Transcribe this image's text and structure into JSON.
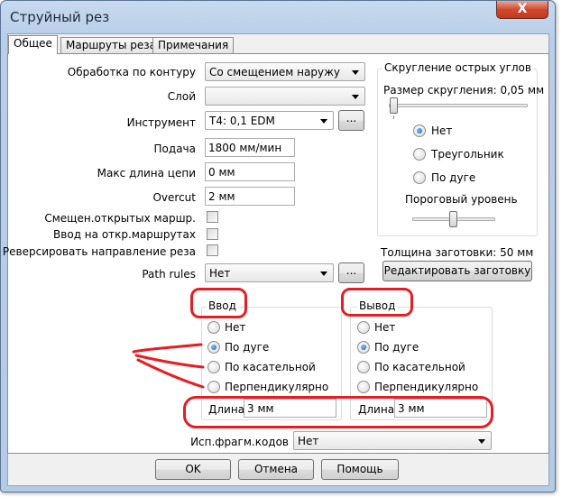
{
  "window": {
    "title": "Струйный рез",
    "close_glyph": "X"
  },
  "tabs": [
    {
      "label": "Общее",
      "active": true
    },
    {
      "label": "Маршруты реза",
      "active": false
    },
    {
      "label": "Примечания",
      "active": false
    }
  ],
  "form": {
    "contour_label": "Обработка по контуру",
    "contour_value": "Со смещением наружу",
    "layer_label": "Слой",
    "layer_value": "",
    "tool_label": "Инструмент",
    "tool_value": "T4: 0,1 EDM",
    "tool_browse": "...",
    "feed_label": "Подача",
    "feed_value": "1800 мм/мин",
    "chain_label": "Макс длина цепи",
    "chain_value": "0 мм",
    "overcut_label": "Overcut",
    "overcut_value": "2 мм",
    "offset_open_label": "Смещен.открытых маршр.",
    "offset_open_checked": false,
    "lead_open_label": "Ввод на откр.маршрутах",
    "lead_open_checked": false,
    "reverse_label": "Реверсировать направление реза",
    "reverse_checked": false,
    "path_rules_label": "Path rules",
    "path_rules_value": "Нет",
    "path_rules_browse": "..."
  },
  "rounding": {
    "title": "Скругление острых углов",
    "size_label": "Размер скругления: 0,05 мм",
    "size_slider_fraction": 0.0,
    "options": [
      {
        "label": "Нет",
        "selected": true
      },
      {
        "label": "Треугольник",
        "selected": false
      },
      {
        "label": "По дуге",
        "selected": false
      }
    ],
    "threshold_label": "Пороговый уровень",
    "threshold_slider_fraction": 0.5
  },
  "stock": {
    "thickness_label": "Толщина заготовки: 50 мм",
    "edit_button": "Редактировать заготовку"
  },
  "lead_in": {
    "title": "Ввод",
    "options": [
      {
        "label": "Нет",
        "selected": false
      },
      {
        "label": "По дуге",
        "selected": true
      },
      {
        "label": "По касательной",
        "selected": false
      },
      {
        "label": "Перпендикулярно",
        "selected": false
      }
    ],
    "length_label": "Длина",
    "length_value": "3 мм"
  },
  "lead_out": {
    "title": "Вывод",
    "options": [
      {
        "label": "Нет",
        "selected": false
      },
      {
        "label": "По дуге",
        "selected": true
      },
      {
        "label": "По касательной",
        "selected": false
      },
      {
        "label": "Перпендикулярно",
        "selected": false
      }
    ],
    "length_label": "Длина",
    "length_value": "3 мм"
  },
  "fragment_codes": {
    "label": "Исп.фрагм.кодов",
    "value": "Нет"
  },
  "footer": {
    "ok": "OK",
    "cancel": "Отмена",
    "help": "Помощь"
  },
  "colors": {
    "annotation": "#e81d23",
    "selected_radio": "#1a5fb4",
    "titlebar": "#b9cfe9"
  }
}
